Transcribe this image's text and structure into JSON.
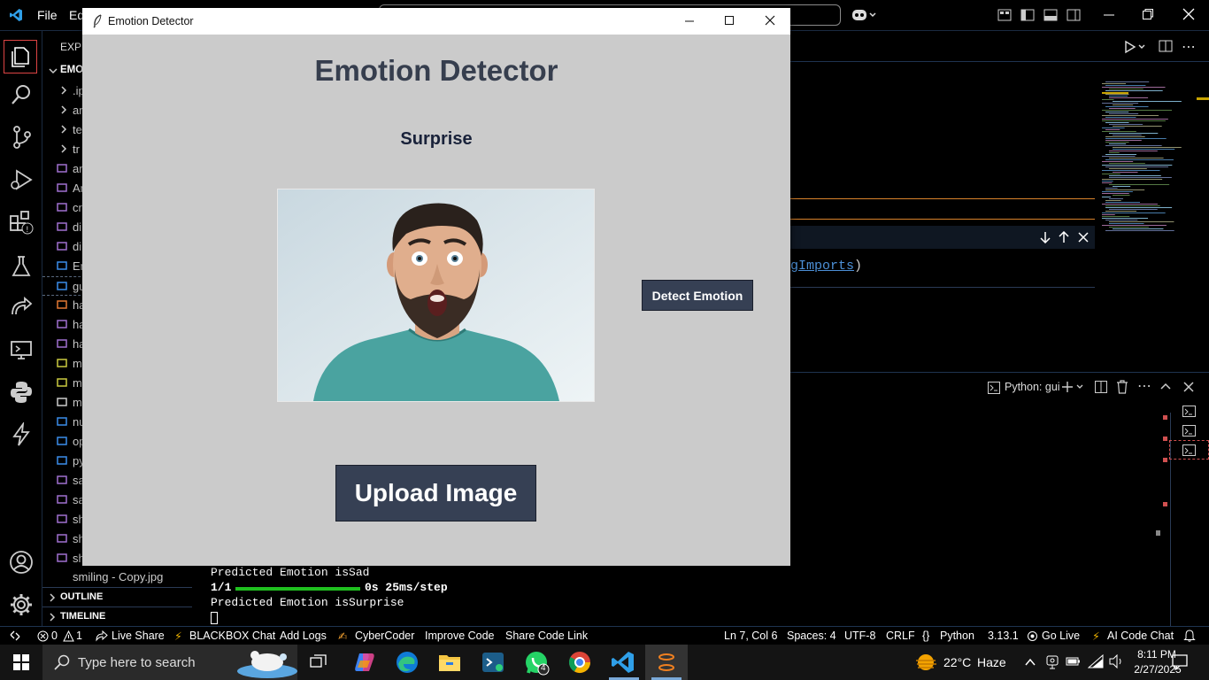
{
  "vscode": {
    "menu": [
      "File",
      "Ed"
    ],
    "sidebar_header": "EXPL",
    "folder": "EMO",
    "tree_items": [
      ".ip",
      "ar",
      "te",
      "tr",
      "ar",
      "An",
      "cr",
      "di",
      "di",
      "En",
      "gu",
      "ha",
      "ha",
      "ha",
      "m",
      "m",
      "m",
      "nu",
      "op",
      "py",
      "sa",
      "sa",
      "sh",
      "sh",
      "sh"
    ],
    "last_file": "smiling - Copy.jpg",
    "outline": "OUTLINE",
    "timeline": "TIMELINE",
    "code_fragment": "gImports",
    "code_paren": ")",
    "terminal_tab": "Python: gui",
    "terminal_lines": [
      "Predicted Emotion isSad",
      "1/1",
      "0s 25ms/step",
      "Predicted Emotion isSurprise"
    ],
    "status": {
      "problems": "0",
      "warnings": "1",
      "live_share": "Live Share",
      "blackbox": "BLACKBOX Chat",
      "add_logs": "Add Logs",
      "cybercoder": "CyberCoder",
      "improve_code": "Improve Code",
      "share_code": "Share Code Link",
      "position": "Ln 7, Col 6",
      "spaces": "Spaces: 4",
      "encoding": "UTF-8",
      "eol": "CRLF",
      "language": "Python",
      "version": "3.13.1",
      "go_live": "Go Live",
      "ai_chat": "AI Code Chat"
    }
  },
  "tk_window": {
    "title": "Emotion Detector",
    "heading": "Emotion Detector",
    "result": "Surprise",
    "detect_button": "Detect Emotion",
    "upload_button": "Upload Image",
    "colors": {
      "bg": "#cbcbcb",
      "button": "#364054",
      "heading": "#363e4e"
    }
  },
  "taskbar": {
    "search_placeholder": "Type here to search",
    "weather_temp": "22°C",
    "weather_desc": "Haze",
    "time": "8:11 PM",
    "date": "2/27/2025",
    "whatsapp_badge": "4"
  }
}
